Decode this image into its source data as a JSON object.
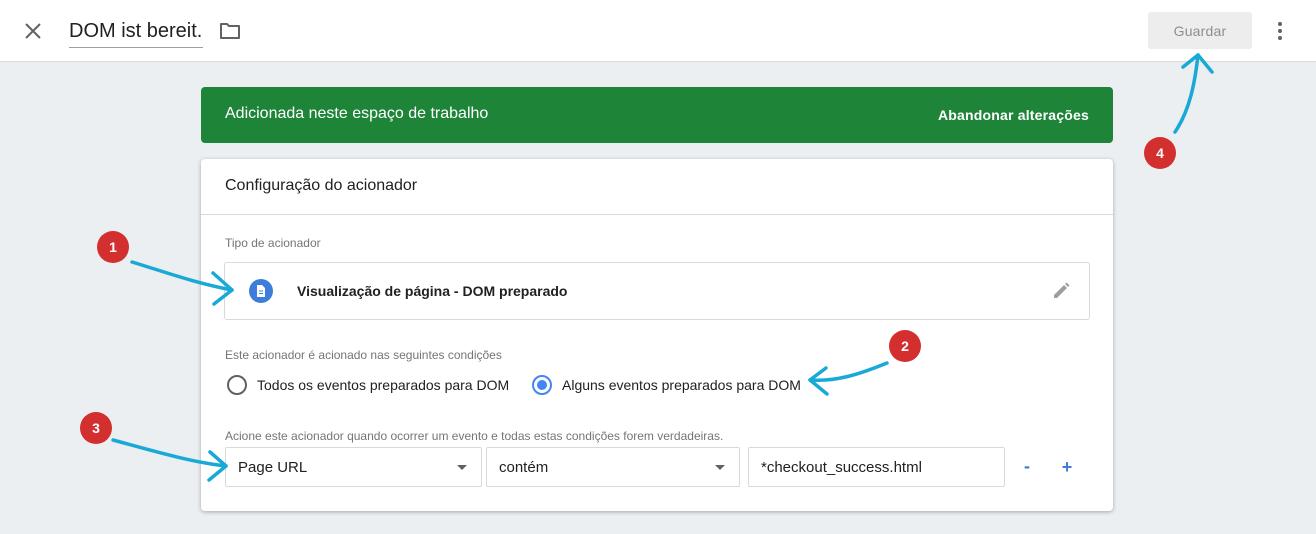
{
  "header": {
    "title": "DOM ist bereit.",
    "save_label": "Guardar"
  },
  "banner": {
    "text": "Adicionada neste espaço de trabalho",
    "action_label": "Abandonar alterações",
    "color": "#1e8538"
  },
  "card": {
    "title": "Configuração do acionador",
    "trigger_type": {
      "label": "Tipo de acionador",
      "name": "Visualização de página - DOM preparado",
      "icon": "document-icon",
      "icon_color": "#3d7ddb"
    },
    "conditions": {
      "label": "Este acionador é acionado nas seguintes condições",
      "options": [
        {
          "label": "Todos os eventos preparados para DOM",
          "selected": false
        },
        {
          "label": "Alguns eventos preparados para DOM",
          "selected": true
        }
      ]
    },
    "filter": {
      "label": "Acione este acionador quando ocorrer um evento e todas estas condições forem verdadeiras.",
      "variable": "Page URL",
      "operator": "contém",
      "value": "*checkout_success.html",
      "remove_label": "-",
      "add_label": "+"
    }
  },
  "annotations": {
    "badges": [
      "1",
      "2",
      "3",
      "4"
    ],
    "badge_color": "#d32f2f",
    "arrow_color": "#18a9d6"
  }
}
